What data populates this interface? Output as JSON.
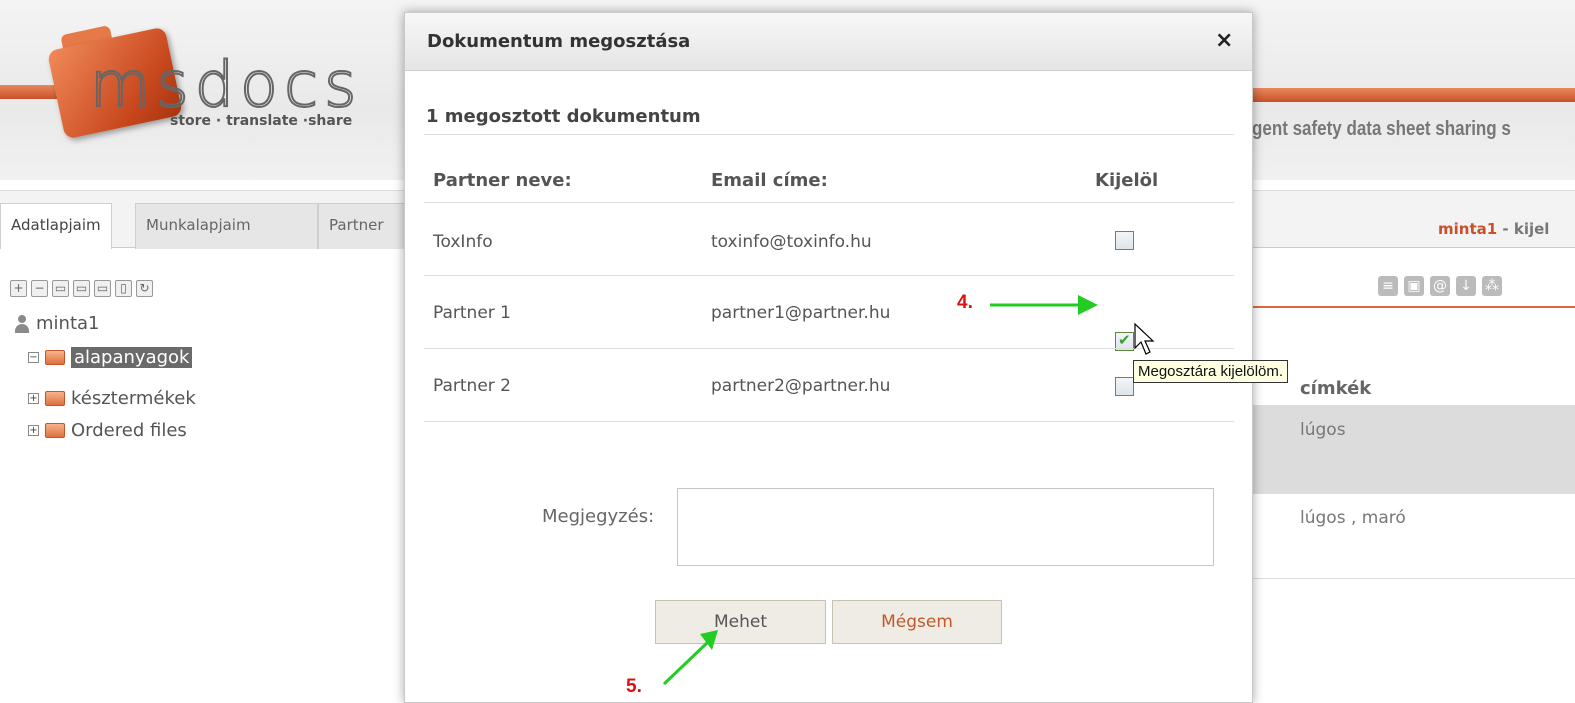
{
  "app": {
    "logo_text": "msdocs",
    "logo_tagline": "store · translate ·share",
    "tagline_right": "gent safety data sheet sharing s"
  },
  "tabs": [
    {
      "label": "Adatlapjaim",
      "active": true
    },
    {
      "label": "Munkalapjaim",
      "active": false
    },
    {
      "label": "Partner",
      "active": false
    }
  ],
  "user_info": {
    "name": "minta1",
    "suffix": " - kijel"
  },
  "tree": {
    "root": "minta1",
    "items": [
      "alapanyagok",
      "késztermékek",
      "Ordered files"
    ]
  },
  "right_panel": {
    "header": "címkék",
    "rows": [
      "lúgos",
      "lúgos , maró"
    ]
  },
  "modal": {
    "title": "Dokumentum megosztása",
    "close_icon": "×",
    "shared_count": "1 megosztott dokumentum",
    "columns": {
      "name": "Partner neve:",
      "email": "Email címe:",
      "select": "Kijelöl"
    },
    "partners": [
      {
        "name": "ToxInfo",
        "email": "toxinfo@toxinfo.hu",
        "checked": false
      },
      {
        "name": "Partner 1",
        "email": "partner1@partner.hu",
        "checked": true
      },
      {
        "name": "Partner 2",
        "email": "partner2@partner.hu",
        "checked": false
      }
    ],
    "note_label": "Megjegyzés:",
    "note_value": "",
    "submit_label": "Mehet",
    "cancel_label": "Mégsem"
  },
  "annotations": {
    "step4": "4.",
    "step5": "5."
  },
  "tooltip": "Megosztára kijelölöm.",
  "colors": {
    "accent": "#c8502a",
    "step_red": "#dd1111",
    "arrow_green": "#22cc22"
  }
}
